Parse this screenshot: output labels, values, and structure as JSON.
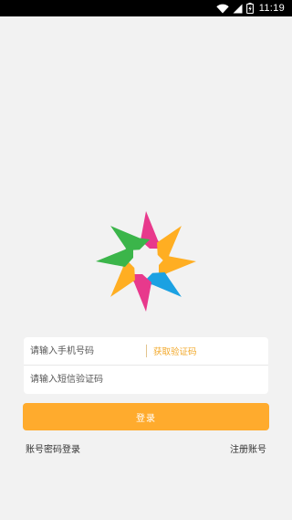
{
  "status_bar": {
    "time": "11:19",
    "icons": [
      "wifi-icon",
      "cell-signal-icon",
      "battery-charging-icon"
    ]
  },
  "logo": {
    "name": "multicolor-star-logo",
    "colors": [
      "#e8398c",
      "#ffae22",
      "#1ba1e2",
      "#3bb54a"
    ]
  },
  "form": {
    "phone_placeholder": "请输入手机号码",
    "get_code_label": "获取验证码",
    "code_placeholder": "请输入短信验证码"
  },
  "login_button": {
    "label": "登录"
  },
  "links": {
    "password_login": "账号密码登录",
    "register": "注册账号"
  },
  "colors": {
    "background": "#f2f2f2",
    "accent": "#ffab2d",
    "link_accent": "#f2a82a"
  }
}
